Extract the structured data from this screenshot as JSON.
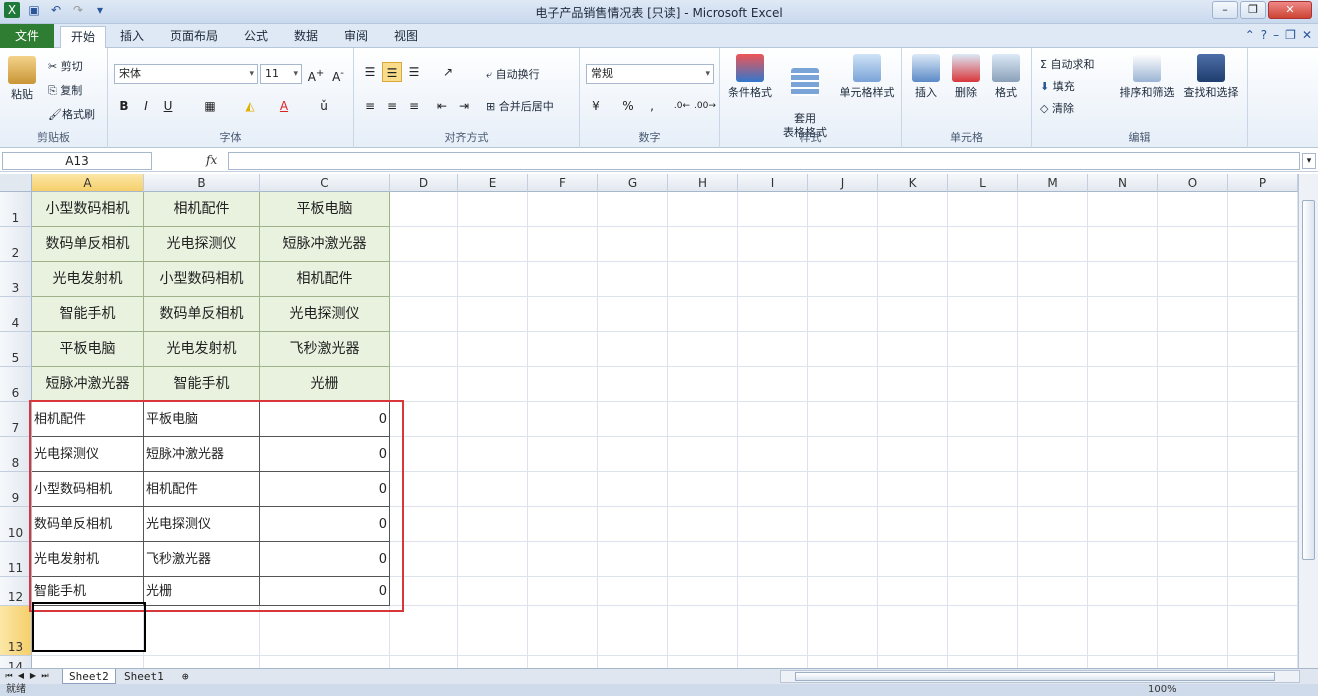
{
  "window": {
    "title": "电子产品销售情况表  [只读]  -  Microsoft Excel"
  },
  "quick_access": [
    "save-icon",
    "undo-icon",
    "redo-icon",
    "customize-icon"
  ],
  "tabs": [
    {
      "label": "文件"
    },
    {
      "label": "开始"
    },
    {
      "label": "插入"
    },
    {
      "label": "页面布局"
    },
    {
      "label": "公式"
    },
    {
      "label": "数据"
    },
    {
      "label": "审阅"
    },
    {
      "label": "视图"
    }
  ],
  "ribbon": {
    "clipboard": {
      "paste": "粘贴",
      "cut": "剪切",
      "copy": "复制",
      "format_painter": "格式刷",
      "label": "剪贴板"
    },
    "font": {
      "name": "宋体",
      "size": "11",
      "label": "字体",
      "bold": "B",
      "italic": "I",
      "underline": "U"
    },
    "alignment": {
      "wrap": "自动换行",
      "merge": "合并后居中",
      "label": "对齐方式"
    },
    "number": {
      "format": "常规",
      "percent": "%",
      "comma": ",",
      "label": "数字"
    },
    "styles": {
      "conditional": "条件格式",
      "table": "套用\n表格格式",
      "cell_styles": "单元格样式",
      "label": "样式"
    },
    "cells": {
      "insert": "插入",
      "delete": "删除",
      "format": "格式",
      "label": "单元格"
    },
    "editing": {
      "autosum": "自动求和",
      "fill": "填充",
      "clear": "清除",
      "sort": "排序和筛选",
      "find": "查找和选择",
      "label": "编辑"
    }
  },
  "formula_bar": {
    "name_box": "A13",
    "fx": "fx",
    "formula": ""
  },
  "columns": [
    "A",
    "B",
    "C",
    "D",
    "E",
    "F",
    "G",
    "H",
    "I",
    "J",
    "K",
    "L",
    "M",
    "N",
    "O",
    "P"
  ],
  "rows": [
    "1",
    "2",
    "3",
    "4",
    "5",
    "6",
    "7",
    "8",
    "9",
    "10",
    "11",
    "12",
    "13",
    "14"
  ],
  "cells": {
    "green": [
      [
        "小型数码相机",
        "相机配件",
        "平板电脑"
      ],
      [
        "数码单反相机",
        "光电探测仪",
        "短脉冲激光器"
      ],
      [
        "光电发射机",
        "小型数码相机",
        "相机配件"
      ],
      [
        "智能手机",
        "数码单反相机",
        "光电探测仪"
      ],
      [
        "平板电脑",
        "光电发射机",
        "飞秒激光器"
      ],
      [
        "短脉冲激光器",
        "智能手机",
        "光栅"
      ]
    ],
    "plain": [
      [
        "相机配件",
        "平板电脑",
        "0"
      ],
      [
        "光电探测仪",
        "短脉冲激光器",
        "0"
      ],
      [
        "小型数码相机",
        "相机配件",
        "0"
      ],
      [
        "数码单反相机",
        "光电探测仪",
        "0"
      ],
      [
        "光电发射机",
        "飞秒激光器",
        "0"
      ],
      [
        "智能手机",
        "光栅",
        "0"
      ]
    ]
  },
  "sheets": [
    {
      "label": "Sheet2",
      "active": true
    },
    {
      "label": "Sheet1",
      "active": false
    }
  ],
  "status": {
    "ready": "就绪",
    "zoom": "100%"
  },
  "colors": {
    "green_fill": "#e8f2df",
    "highlight": "#d9363a",
    "file_tab": "#2f7d32"
  }
}
